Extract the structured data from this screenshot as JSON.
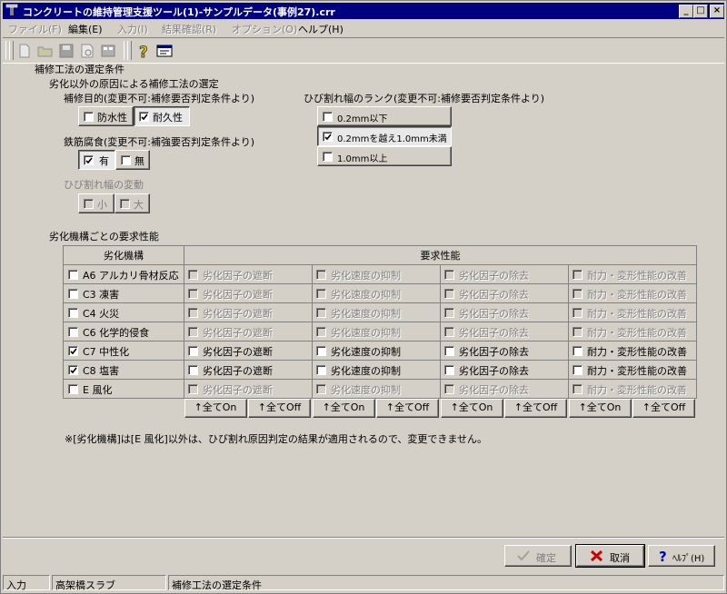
{
  "window": {
    "title": "コンクリートの維持管理支援ツール(1)-サンプルデータ(事例27).crr"
  },
  "menu": [
    "ファイル(F)",
    "編集(E)",
    "入力(I)",
    "結果確認(R)",
    "オプション(O)",
    "ヘルプ(H)"
  ],
  "section_title": "補修工法の選定条件",
  "sub_title": "劣化以外の原因による補修工法の選定",
  "purpose": {
    "label": "補修目的(変更不可:補修要否判定条件より)",
    "options": [
      "防水性",
      "耐久性"
    ]
  },
  "corrosion": {
    "label": "鉄筋腐食(変更不可:補強要否判定条件より)",
    "options": [
      "有",
      "無"
    ]
  },
  "crack_change": {
    "label": "ひび割れ幅の変動",
    "options": [
      "小",
      "大"
    ]
  },
  "crack_rank": {
    "label": "ひび割れ幅のランク(変更不可:補修要否判定条件より)",
    "options": [
      "0.2mm以下",
      "0.2mmを越え1.0mm未満",
      "1.0mm以上"
    ]
  },
  "perf_title": "劣化機構ごとの要求性能",
  "table": {
    "header_mech": "劣化機構",
    "header_perf": "要求性能",
    "perf_cols": [
      "劣化因子の遮断",
      "劣化速度の抑制",
      "劣化因子の除去",
      "耐力・変形性能の改善"
    ],
    "rows": [
      {
        "name": "A6 アルカリ骨材反応"
      },
      {
        "name": "C3 凍害"
      },
      {
        "name": "C4 火災"
      },
      {
        "name": "C6 化学的侵食"
      },
      {
        "name": "C7 中性化"
      },
      {
        "name": "C8 塩害"
      },
      {
        "name": "E 風化"
      }
    ],
    "all_on": "↑全てOn",
    "all_off": "↑全てOff"
  },
  "note": "※[劣化機構]は[E 風化]以外は、ひび割れ原因判定の結果が適用されるので、変更できません。",
  "buttons": {
    "ok": "確定",
    "cancel": "取消",
    "help": "ﾍﾙﾌﾟ(H)"
  },
  "status": [
    "入力",
    "高架橋スラブ",
    "補修工法の選定条件"
  ]
}
